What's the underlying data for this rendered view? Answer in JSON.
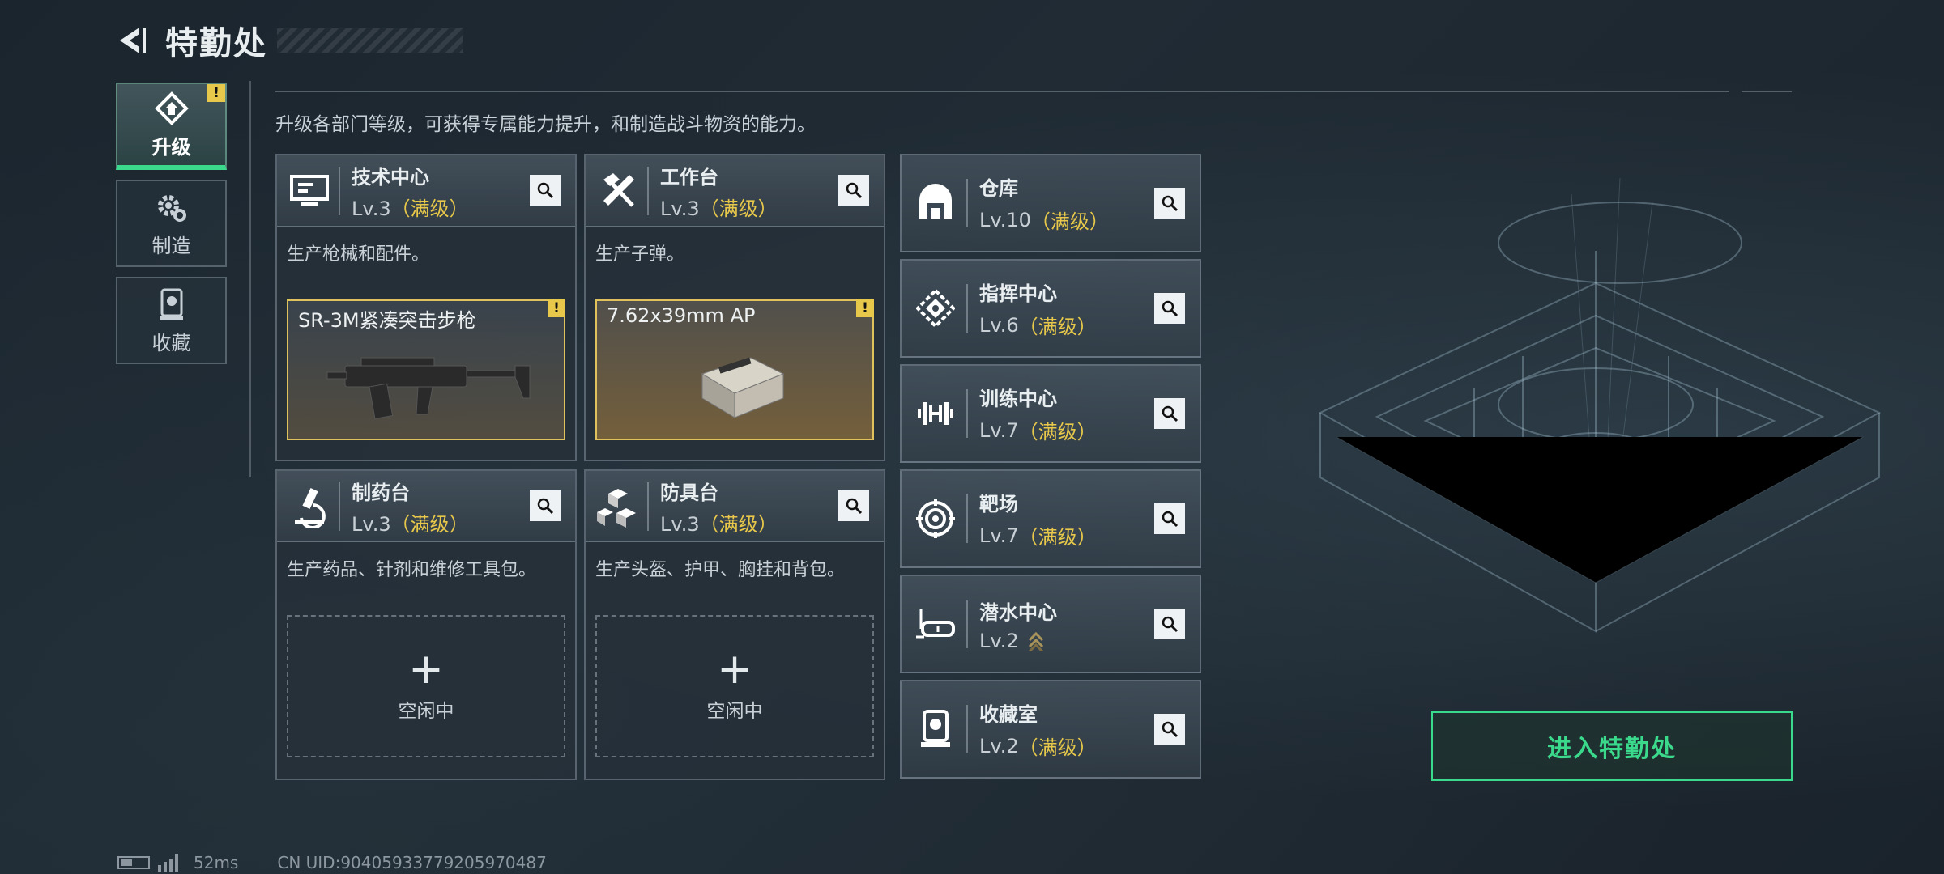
{
  "header": {
    "title": "特勤处"
  },
  "side_tabs": [
    {
      "label": "升级",
      "active": true,
      "warning": "!"
    },
    {
      "label": "制造",
      "active": false
    },
    {
      "label": "收藏",
      "active": false
    }
  ],
  "subtitle": "升级各部门等级，可获得专属能力提升，和制造战斗物资的能力。",
  "production": [
    {
      "name": "技术中心",
      "level": "Lv.3",
      "max": "（满级）",
      "desc": "生产枪械和配件。",
      "icon": "monitor-icon",
      "slot": {
        "type": "item",
        "item_name": "SR-3M紧凑突击步枪",
        "warning": "!"
      }
    },
    {
      "name": "工作台",
      "level": "Lv.3",
      "max": "（满级）",
      "desc": "生产子弹。",
      "icon": "tools-icon",
      "slot": {
        "type": "item",
        "item_name": "7.62x39mm AP",
        "warning": "!"
      }
    },
    {
      "name": "制药台",
      "level": "Lv.3",
      "max": "（满级）",
      "desc": "生产药品、针剂和维修工具包。",
      "icon": "microscope-icon",
      "slot": {
        "type": "empty",
        "plus": "+",
        "idle": "空闲中"
      }
    },
    {
      "name": "防具台",
      "level": "Lv.3",
      "max": "（满级）",
      "desc": "生产头盔、护甲、胸挂和背包。",
      "icon": "armor-cubes-icon",
      "slot": {
        "type": "empty",
        "plus": "+",
        "idle": "空闲中"
      }
    }
  ],
  "facilities": [
    {
      "name": "仓库",
      "level": "Lv.10",
      "max": "（满级）",
      "icon": "warehouse-icon"
    },
    {
      "name": "指挥中心",
      "level": "Lv.6",
      "max": "（满级）",
      "icon": "command-icon"
    },
    {
      "name": "训练中心",
      "level": "Lv.7",
      "max": "（满级）",
      "icon": "dumbbell-icon"
    },
    {
      "name": "靶场",
      "level": "Lv.7",
      "max": "（满级）",
      "icon": "target-icon"
    },
    {
      "name": "潜水中心",
      "level": "Lv.2",
      "max": "",
      "icon": "diving-mask-icon",
      "upgradeable": true
    },
    {
      "name": "收藏室",
      "level": "Lv.2",
      "max": "（满级）",
      "icon": "collection-icon"
    }
  ],
  "enter_button": {
    "label": "进入特勤处"
  },
  "status_bar": {
    "ping": "52ms",
    "uid": "CN UID:90405933779205970487"
  },
  "colors": {
    "accent_green": "#3bd98c",
    "max_gold": "#e7c84a",
    "warning_yellow": "#e7c84a"
  }
}
